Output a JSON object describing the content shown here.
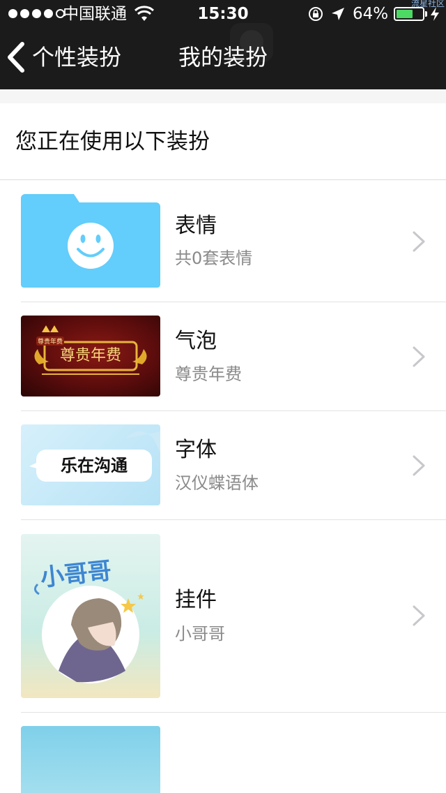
{
  "status_bar": {
    "carrier": "中国联通",
    "time": "15:30",
    "battery_percent": "64%",
    "battery_level": 0.64,
    "watermark": "流星社区"
  },
  "nav": {
    "back_label": "个性装扮",
    "title": "我的装扮"
  },
  "section": {
    "title": "您正在使用以下装扮"
  },
  "items": [
    {
      "title": "表情",
      "subtitle": "共0套表情",
      "thumb_color": "#5ec8f8"
    },
    {
      "title": "气泡",
      "subtitle": "尊贵年费",
      "thumb_text": "尊贵年费",
      "badge_text": "尊贵年费",
      "thumb_color": "#5a0c0c"
    },
    {
      "title": "字体",
      "subtitle": "汉仪蝶语体",
      "thumb_text": "乐在沟通",
      "thumb_color": "#bfe6f7"
    },
    {
      "title": "挂件",
      "subtitle": "小哥哥",
      "thumb_text": "小哥哥",
      "thumb_color": "#cfeee6"
    }
  ],
  "colors": {
    "nav_background": "#1b1b1b",
    "battery_green": "#4cd964",
    "chevron_gray": "#c7c7cc",
    "subtitle_gray": "#8a8a8a"
  }
}
